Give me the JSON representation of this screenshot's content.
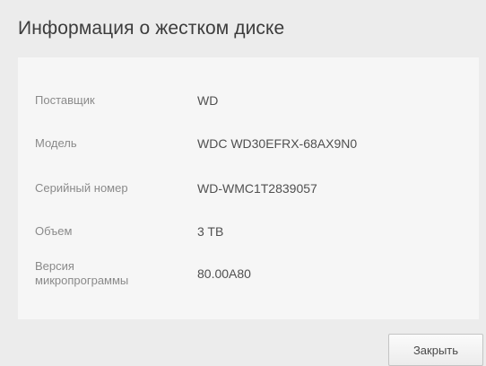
{
  "dialog": {
    "title": "Информация о жестком диске",
    "close_label": "Закрыть"
  },
  "disk_info": [
    {
      "label": "Поставщик",
      "value": "WD"
    },
    {
      "label": "Модель",
      "value": "WDC WD30EFRX-68AX9N0"
    },
    {
      "label": "Серийный номер",
      "value": "WD-WMC1T2839057"
    },
    {
      "label": "Объем",
      "value": "3 TB"
    },
    {
      "label": "Версия микропрограммы",
      "value": "80.00A80"
    }
  ]
}
